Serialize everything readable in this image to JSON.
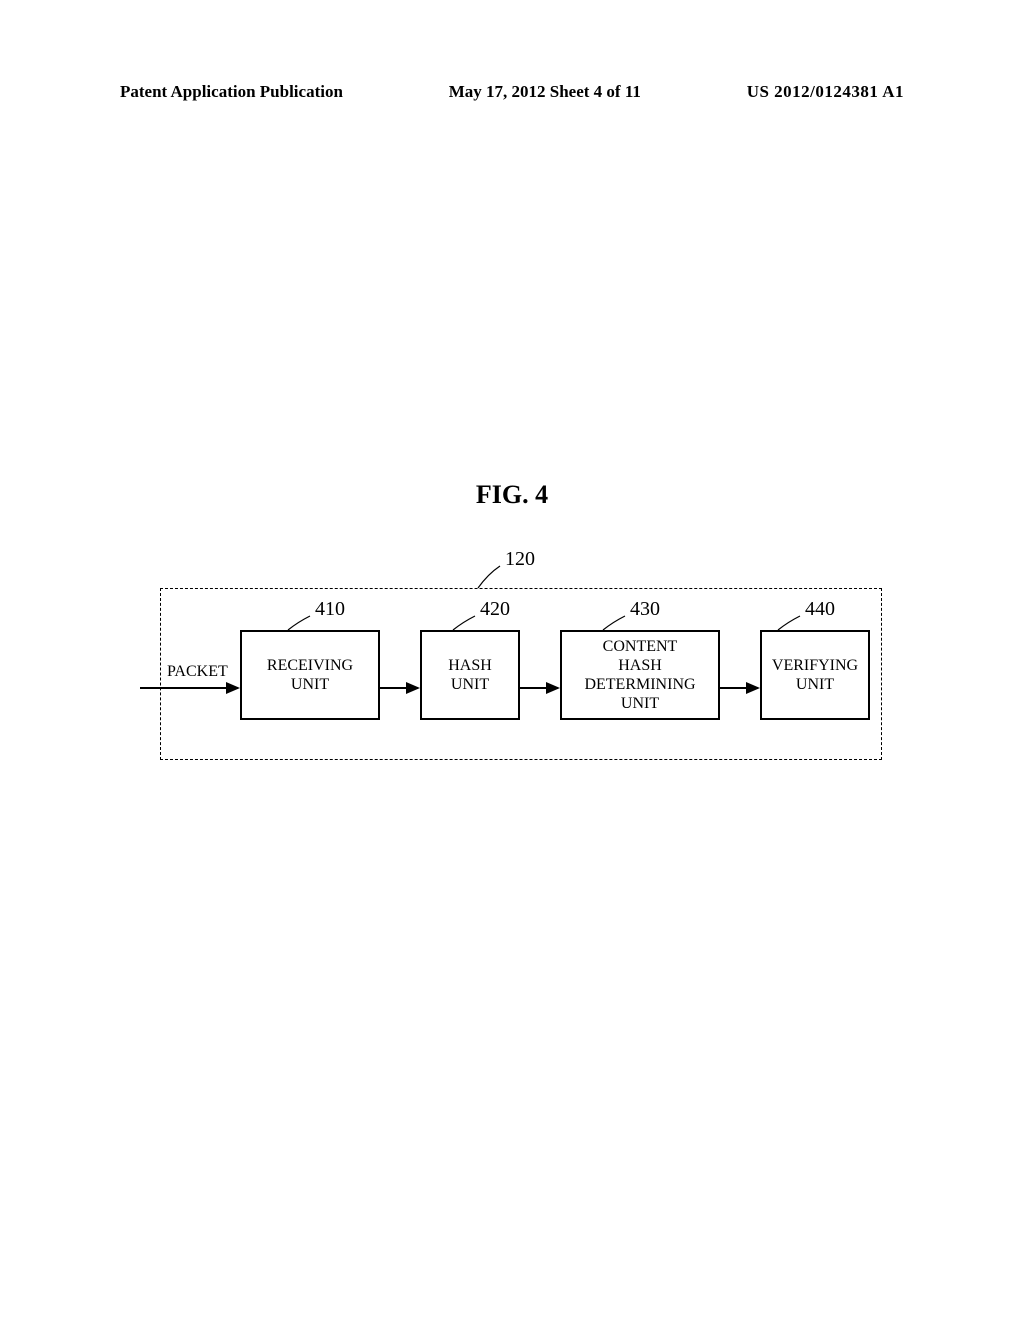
{
  "header": {
    "left": "Patent Application Publication",
    "mid": "May 17, 2012  Sheet 4 of 11",
    "right": "US 2012/0124381 A1"
  },
  "figure_title": "FIG. 4",
  "packet_label": "PACKET",
  "refs": {
    "outer": "120",
    "u1": "410",
    "u2": "420",
    "u3": "430",
    "u4": "440"
  },
  "units": {
    "u1": "RECEIVING\nUNIT",
    "u2": "HASH\nUNIT",
    "u3": "CONTENT\nHASH\nDETERMINING\nUNIT",
    "u4": "VERIFYING\nUNIT"
  }
}
